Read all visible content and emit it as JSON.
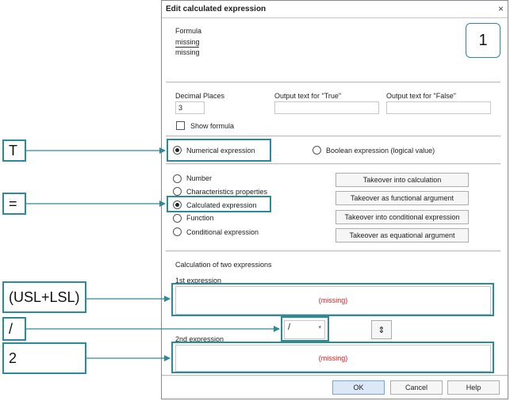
{
  "dialog": {
    "title": "Edit calculated expression",
    "close_glyph": "×"
  },
  "formula": {
    "label": "Formula",
    "numerator": "missing",
    "denominator": "missing"
  },
  "step_badge": "1",
  "decimal": {
    "label": "Decimal Places",
    "value": "3"
  },
  "true_text": {
    "label": "Output text for \"True\"",
    "value": ""
  },
  "false_text": {
    "label": "Output text for \"False\"",
    "value": ""
  },
  "show_formula": {
    "label": "Show formula",
    "checked": false
  },
  "expression_type": {
    "numerical": "Numerical expression",
    "boolean": "Boolean expression (logical value)",
    "selected": "numerical"
  },
  "element_types": {
    "items": [
      "Number",
      "Characteristics properties",
      "Calculated expression",
      "Function",
      "Conditional expression"
    ],
    "selected": 2
  },
  "actions": {
    "takeover_calc": "Takeover into calculation",
    "takeover_func": "Takeover as functional argument",
    "takeover_cond": "Takeover into conditional expression",
    "takeover_eq": "Takeover as equational argument"
  },
  "calc": {
    "section_label": "Calculation of two expressions",
    "first_label": "1st expression",
    "first_value": "(missing)",
    "operator": "/",
    "swap_icon": "⇕",
    "second_label": "2nd expression",
    "second_value": "(missing)"
  },
  "footer": {
    "ok": "OK",
    "cancel": "Cancel",
    "help": "Help"
  },
  "annotations": {
    "t": "T",
    "eq": "=",
    "usl_lsl": "(USL+LSL)",
    "slash": "/",
    "two": "2"
  },
  "colors": {
    "callout": "#2b8c97",
    "missing_text": "#e02020",
    "ok_button": "#dbe8f7"
  }
}
